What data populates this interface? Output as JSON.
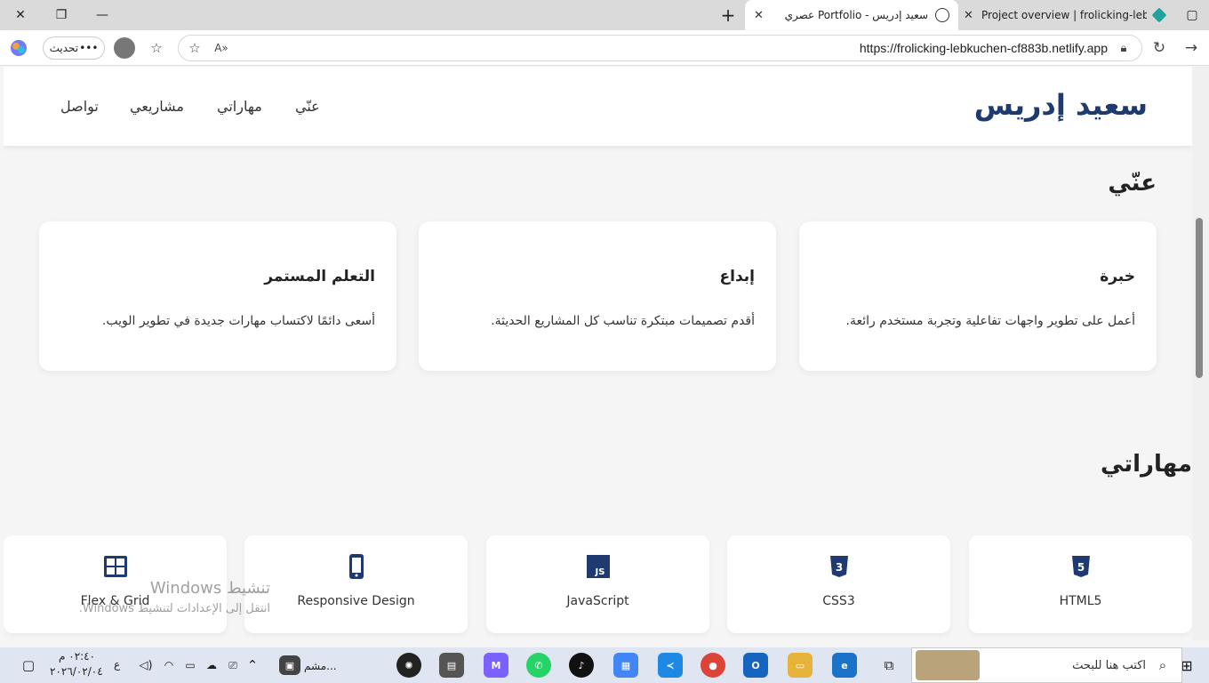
{
  "browser": {
    "tabs": [
      {
        "title": "سعيد إدريس - Portfolio عصري"
      },
      {
        "title": "Project overview | frolicking-lebku"
      }
    ],
    "url": "https://frolicking-lebkuchen-cf883b.netlify.app",
    "refresh_label": "تحديث"
  },
  "site": {
    "logo": "سعيد إدريس",
    "nav": [
      "عنّي",
      "مهاراتي",
      "مشاريعي",
      "تواصل"
    ]
  },
  "about": {
    "title": "عنّي",
    "cards": [
      {
        "title": "خبرة",
        "text": "أعمل على تطوير واجهات تفاعلية وتجربة مستخدم رائعة."
      },
      {
        "title": "إبداع",
        "text": "أقدم تصميمات مبتكرة تناسب كل المشاريع الحديثة."
      },
      {
        "title": "التعلم المستمر",
        "text": "أسعى دائمًا لاكتساب مهارات جديدة في تطوير الويب."
      }
    ]
  },
  "skills": {
    "title": "مهاراتي",
    "items": [
      {
        "label": "HTML5",
        "icon": "html5-icon"
      },
      {
        "label": "CSS3",
        "icon": "css3-icon"
      },
      {
        "label": "JavaScript",
        "icon": "javascript-icon"
      },
      {
        "label": "Responsive Design",
        "icon": "mobile-icon"
      },
      {
        "label": "Flex & Grid",
        "icon": "grid-icon"
      }
    ]
  },
  "watermark": {
    "activate_title": "تنشيط Windows",
    "activate_sub": "انتقل إلى الإعدادات لتنشيط Windows."
  },
  "taskbar": {
    "search_placeholder": "اكتب هنا للبحث",
    "time": "٠٢:٤٠ م",
    "date": "٢٠٢٦/٠٢/٠٤",
    "lang": "ع",
    "app_label": "مشم..."
  },
  "colors": {
    "brand": "#1e3a6e",
    "tab_icon": "#1fa39a"
  }
}
